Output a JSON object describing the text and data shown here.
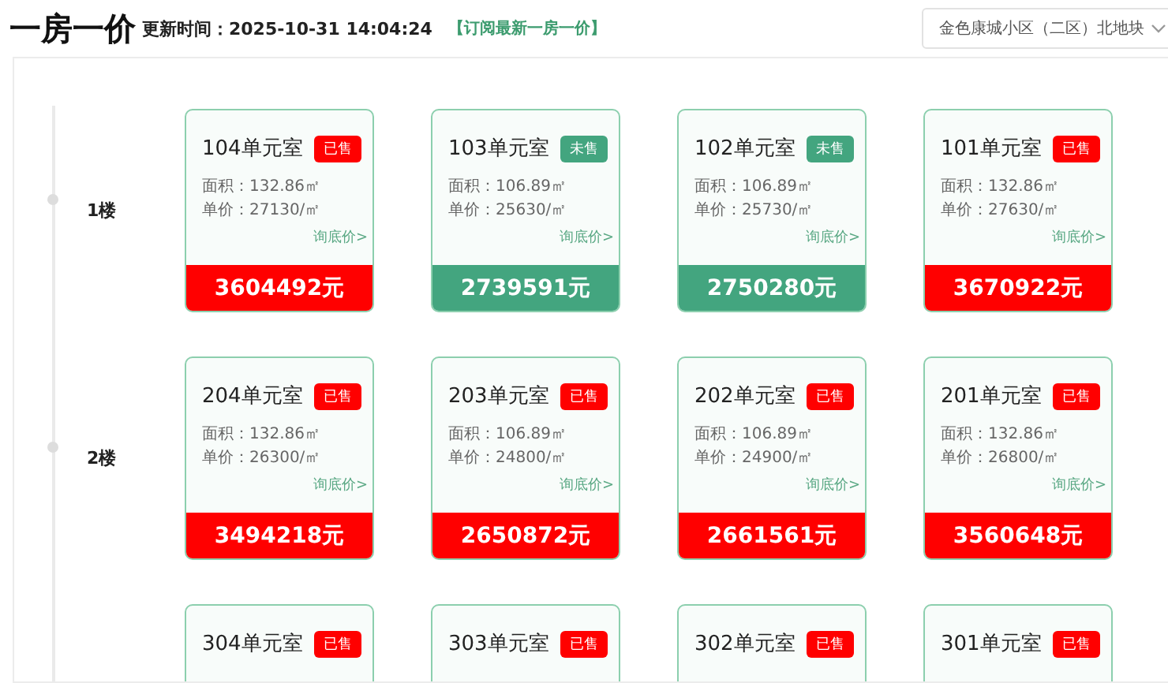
{
  "header": {
    "title": "一房一价",
    "update_label": "更新时间：",
    "update_time": "2025-10-31 14:04:24",
    "subscribe_link": "【订阅最新一房一价】",
    "project_select": "金色康城小区（二区）北地块"
  },
  "floors": [
    {
      "label": "1楼",
      "units": [
        {
          "name": "104单元室",
          "kind": "sold",
          "badge": "已售",
          "area": "面积：132.86㎡",
          "unit_price": "单价：27130/㎡",
          "inquiry": "询底价>",
          "total": "3604492元"
        },
        {
          "name": "103单元室",
          "kind": "unsold",
          "badge": "未售",
          "area": "面积：106.89㎡",
          "unit_price": "单价：25630/㎡",
          "inquiry": "询底价>",
          "total": "2739591元"
        },
        {
          "name": "102单元室",
          "kind": "unsold",
          "badge": "未售",
          "area": "面积：106.89㎡",
          "unit_price": "单价：25730/㎡",
          "inquiry": "询底价>",
          "total": "2750280元"
        },
        {
          "name": "101单元室",
          "kind": "sold",
          "badge": "已售",
          "area": "面积：132.86㎡",
          "unit_price": "单价：27630/㎡",
          "inquiry": "询底价>",
          "total": "3670922元"
        }
      ]
    },
    {
      "label": "2楼",
      "units": [
        {
          "name": "204单元室",
          "kind": "sold",
          "badge": "已售",
          "area": "面积：132.86㎡",
          "unit_price": "单价：26300/㎡",
          "inquiry": "询底价>",
          "total": "3494218元"
        },
        {
          "name": "203单元室",
          "kind": "sold",
          "badge": "已售",
          "area": "面积：106.89㎡",
          "unit_price": "单价：24800/㎡",
          "inquiry": "询底价>",
          "total": "2650872元"
        },
        {
          "name": "202单元室",
          "kind": "sold",
          "badge": "已售",
          "area": "面积：106.89㎡",
          "unit_price": "单价：24900/㎡",
          "inquiry": "询底价>",
          "total": "2661561元"
        },
        {
          "name": "201单元室",
          "kind": "sold",
          "badge": "已售",
          "area": "面积：132.86㎡",
          "unit_price": "单价：26800/㎡",
          "inquiry": "询底价>",
          "total": "3560648元"
        }
      ]
    },
    {
      "units": [
        {
          "name": "304单元室",
          "kind": "sold",
          "badge": "已售"
        },
        {
          "name": "303单元室",
          "kind": "sold",
          "badge": "已售"
        },
        {
          "name": "302单元室",
          "kind": "sold",
          "badge": "已售"
        },
        {
          "name": "301单元室",
          "kind": "sold",
          "badge": "已售"
        }
      ]
    }
  ]
}
